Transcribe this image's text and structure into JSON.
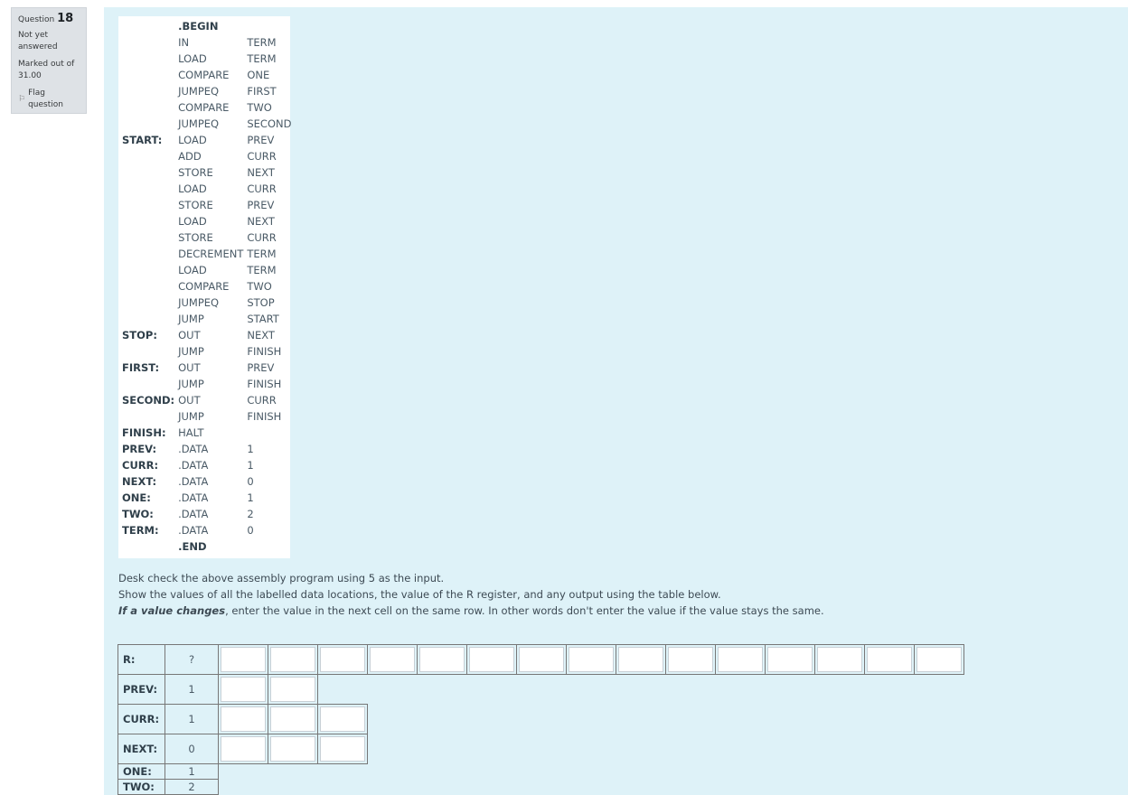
{
  "question_info": {
    "question_label": "Question",
    "question_number": "18",
    "state": "Not yet answered",
    "grade": "Marked out of 31.00",
    "flag_label": "Flag question",
    "flag_icon": "flag-icon"
  },
  "program": {
    "lines": [
      {
        "label": "",
        "op": ".BEGIN",
        "arg": "",
        "directive": true
      },
      {
        "label": "",
        "op": "IN",
        "arg": "TERM"
      },
      {
        "label": "",
        "op": "LOAD",
        "arg": "TERM"
      },
      {
        "label": "",
        "op": "COMPARE",
        "arg": "ONE"
      },
      {
        "label": "",
        "op": "JUMPEQ",
        "arg": "FIRST"
      },
      {
        "label": "",
        "op": "COMPARE",
        "arg": "TWO"
      },
      {
        "label": "",
        "op": "JUMPEQ",
        "arg": "SECOND"
      },
      {
        "label": "START:",
        "op": "LOAD",
        "arg": "PREV"
      },
      {
        "label": "",
        "op": "ADD",
        "arg": "CURR"
      },
      {
        "label": "",
        "op": "STORE",
        "arg": " NEXT"
      },
      {
        "label": "",
        "op": "LOAD",
        "arg": "CURR"
      },
      {
        "label": "",
        "op": "STORE",
        "arg": "PREV"
      },
      {
        "label": "",
        "op": "LOAD",
        "arg": "NEXT"
      },
      {
        "label": "",
        "op": "STORE",
        "arg": "CURR"
      },
      {
        "label": "",
        "op": "DECREMENT",
        "arg": "TERM"
      },
      {
        "label": "",
        "op": "LOAD",
        "arg": "TERM"
      },
      {
        "label": "",
        "op": "COMPARE",
        "arg": "TWO"
      },
      {
        "label": "",
        "op": "JUMPEQ",
        "arg": "STOP"
      },
      {
        "label": "",
        "op": "JUMP",
        "arg": "START"
      },
      {
        "label": "STOP:",
        "op": "OUT",
        "arg": "NEXT"
      },
      {
        "label": "",
        "op": "JUMP",
        "arg": "FINISH"
      },
      {
        "label": "FIRST:",
        "op": "OUT",
        "arg": "PREV"
      },
      {
        "label": "",
        "op": "JUMP",
        "arg": "FINISH"
      },
      {
        "label": "SECOND:",
        "op": "OUT",
        "arg": "CURR"
      },
      {
        "label": "",
        "op": "JUMP",
        "arg": "FINISH"
      },
      {
        "label": "FINISH:",
        "op": "HALT",
        "arg": ""
      },
      {
        "label": "PREV:",
        "op": ".DATA",
        "arg": "1"
      },
      {
        "label": "CURR:",
        "op": ".DATA",
        "arg": "1"
      },
      {
        "label": "NEXT:",
        "op": ".DATA",
        "arg": "0"
      },
      {
        "label": "ONE:",
        "op": ".DATA",
        "arg": "1"
      },
      {
        "label": "TWO:",
        "op": ".DATA",
        "arg": "2"
      },
      {
        "label": "TERM:",
        "op": ".DATA",
        "arg": "0"
      },
      {
        "label": "",
        "op": ".END",
        "arg": "",
        "directive": true
      }
    ]
  },
  "instructions": {
    "line1": "Desk check the above assembly program using 5 as the input.",
    "line2": "Show the values of all the labelled data locations, the value of the R register, and any output using the table below.",
    "line3_emphasis": "If a value changes",
    "line3_rest": ", enter the value in the next cell on the same row. In other words don't enter the value if the value stays the same."
  },
  "desk_check": {
    "rows": [
      {
        "label": "R:",
        "initial": "?",
        "inputs": 15,
        "size": "tall"
      },
      {
        "label": "PREV:",
        "initial": "1",
        "inputs": 2,
        "size": "tall"
      },
      {
        "label": "CURR:",
        "initial": "1",
        "inputs": 3,
        "size": "tall"
      },
      {
        "label": "NEXT:",
        "initial": "0",
        "inputs": 3,
        "size": "tall"
      },
      {
        "label": "ONE:",
        "initial": "1",
        "inputs": 0,
        "size": "short"
      },
      {
        "label": "TWO:",
        "initial": "2",
        "inputs": 0,
        "size": "short"
      }
    ]
  }
}
